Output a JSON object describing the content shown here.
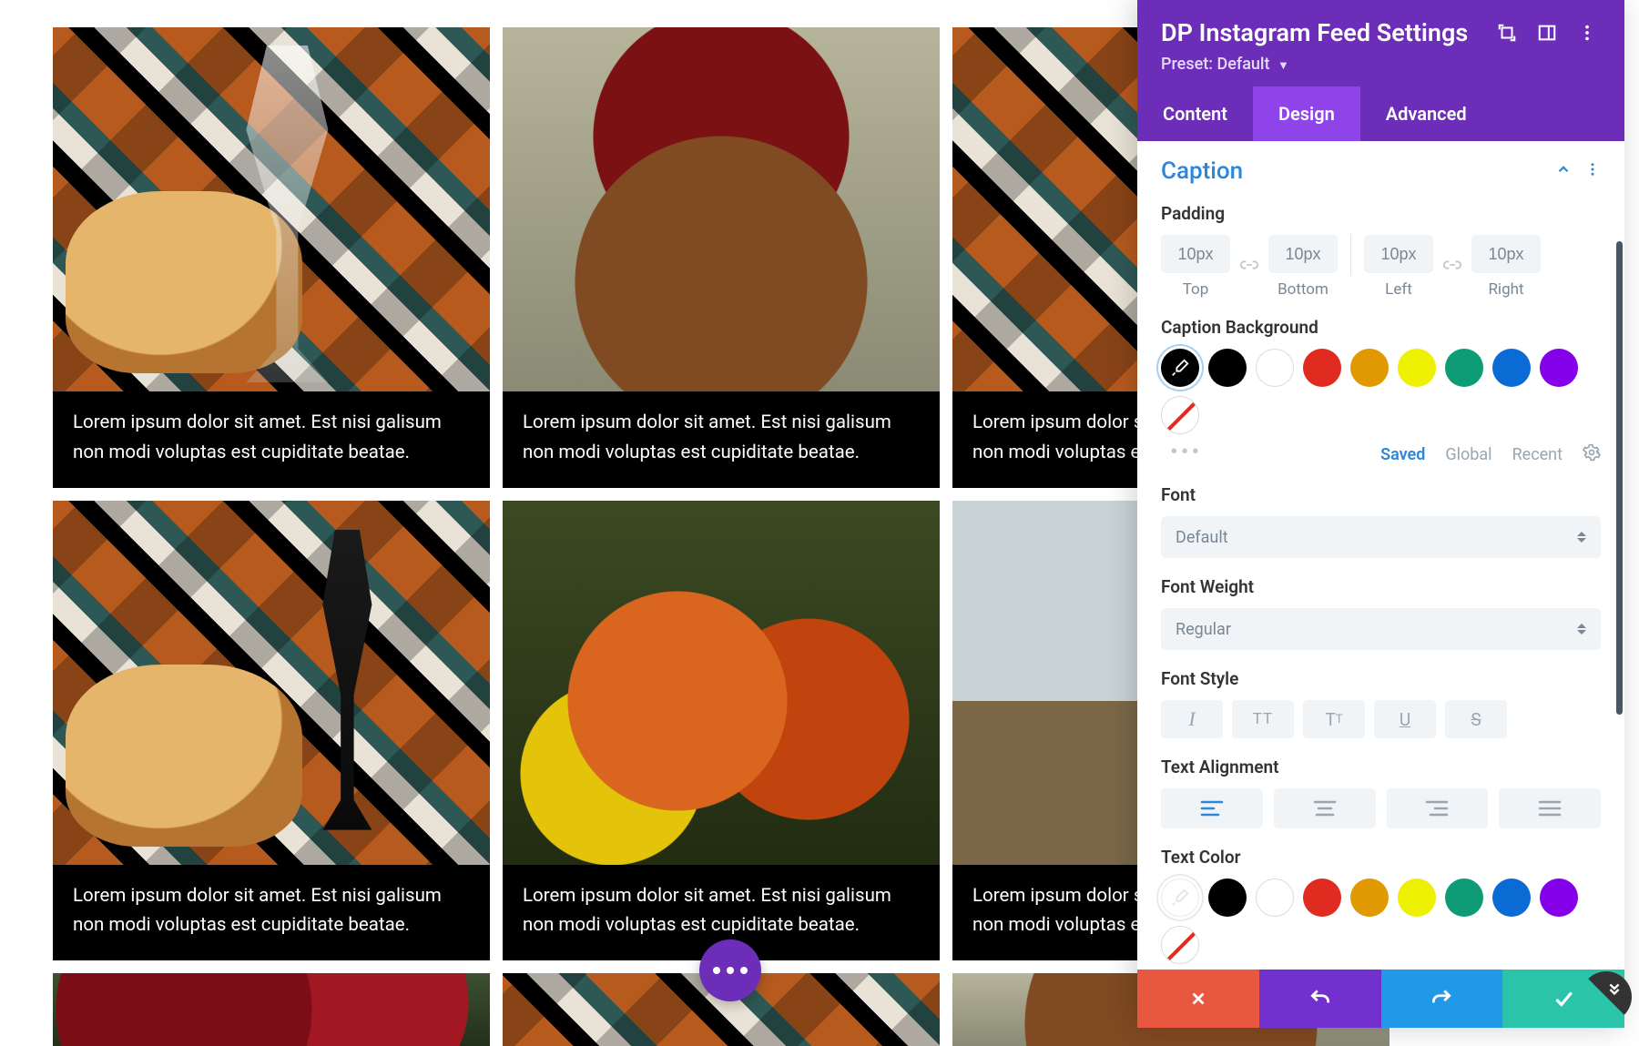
{
  "feed": {
    "caption_text": "Lorem ipsum dolor sit amet. Est nisi galisum non modi voluptas est cupiditate beatae."
  },
  "panel": {
    "title": "DP Instagram Feed Settings",
    "preset_label": "Preset:",
    "preset_value": "Default",
    "tabs": {
      "content": "Content",
      "design": "Design",
      "advanced": "Advanced",
      "active": "design"
    },
    "section_title": "Caption",
    "padding": {
      "label": "Padding",
      "top": {
        "value": "10px",
        "sub": "Top"
      },
      "bottom": {
        "value": "10px",
        "sub": "Bottom"
      },
      "left": {
        "value": "10px",
        "sub": "Left"
      },
      "right": {
        "value": "10px",
        "sub": "Right"
      }
    },
    "caption_bg_label": "Caption Background",
    "palette_tabs": {
      "saved": "Saved",
      "global": "Global",
      "recent": "Recent"
    },
    "font_label": "Font",
    "font_value": "Default",
    "font_weight_label": "Font Weight",
    "font_weight_value": "Regular",
    "font_style_label": "Font Style",
    "text_align_label": "Text Alignment",
    "text_color_label": "Text Color",
    "colors": {
      "black": "#000000",
      "white": "#ffffff",
      "red": "#e02b20",
      "orange": "#e09900",
      "yellow": "#edf000",
      "teal": "#0c9b74",
      "blue": "#0b6bd4",
      "purple": "#8300e9"
    }
  }
}
